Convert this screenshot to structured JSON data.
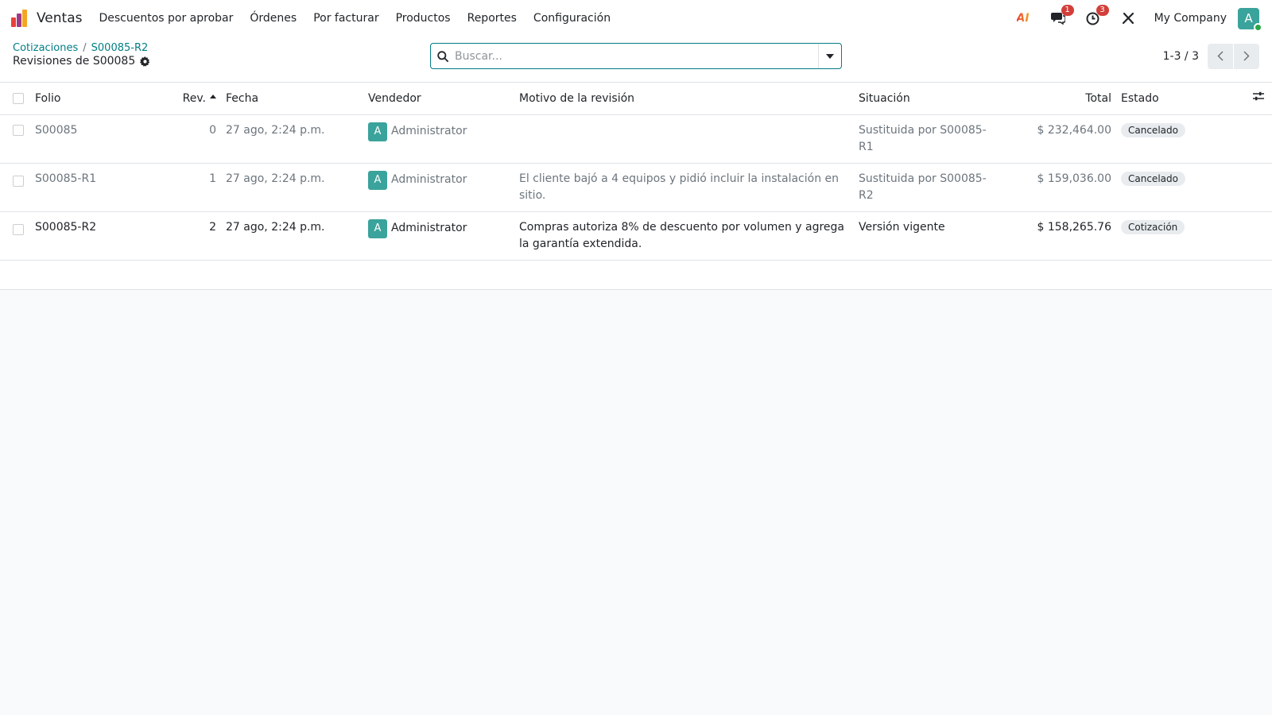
{
  "navbar": {
    "app_name": "Ventas",
    "menu": [
      "Descuentos por aprobar",
      "Órdenes",
      "Por facturar",
      "Productos",
      "Reportes",
      "Configuración"
    ],
    "ai_label": "AI",
    "messages_badge": "1",
    "activities_badge": "3",
    "company": "My Company",
    "user_initial": "A"
  },
  "control": {
    "breadcrumb": [
      "Cotizaciones",
      "S00085-R2"
    ],
    "breadcrumb_sep": "/",
    "title": "Revisiones de S00085",
    "search_placeholder": "Buscar...",
    "pager": "1-3 / 3"
  },
  "table": {
    "headers": {
      "folio": "Folio",
      "rev": "Rev.",
      "fecha": "Fecha",
      "vendedor": "Vendedor",
      "motivo": "Motivo de la revisión",
      "situacion": "Situación",
      "total": "Total",
      "estado": "Estado"
    },
    "rows": [
      {
        "folio": "S00085",
        "rev": "0",
        "fecha": "27 ago, 2:24 p.m.",
        "vendedor_initial": "A",
        "vendedor": "Administrator",
        "motivo": "",
        "situacion": "Sustituida por S00085-R1",
        "total": "$ 232,464.00",
        "estado": "Cancelado"
      },
      {
        "folio": "S00085-R1",
        "rev": "1",
        "fecha": "27 ago, 2:24 p.m.",
        "vendedor_initial": "A",
        "vendedor": "Administrator",
        "motivo": "El cliente bajó a 4 equipos y pidió incluir la instalación en sitio.",
        "situacion": "Sustituida por S00085-R2",
        "total": "$ 159,036.00",
        "estado": "Cancelado"
      },
      {
        "folio": "S00085-R2",
        "rev": "2",
        "fecha": "27 ago, 2:24 p.m.",
        "vendedor_initial": "A",
        "vendedor": "Administrator",
        "motivo": "Compras autoriza 8% de descuento por volumen y agrega la garantía extendida.",
        "situacion": "Versión vigente",
        "total": "$ 158,265.76",
        "estado": "Cotización"
      }
    ]
  },
  "colors": {
    "accent": "#017e84",
    "avatar": "#3aa39b",
    "badge_red": "#d23f3a"
  }
}
